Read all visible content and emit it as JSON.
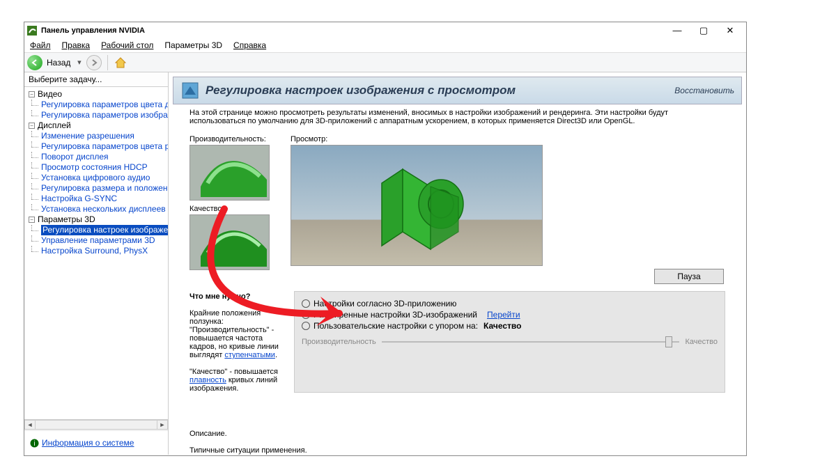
{
  "titlebar": {
    "title": "Панель управления NVIDIA"
  },
  "menu": {
    "file": "Файл",
    "edit": "Правка",
    "desktop": "Рабочий стол",
    "params3d": "Параметры 3D",
    "help": "Справка"
  },
  "toolbar": {
    "back_label": "Назад"
  },
  "sidebar": {
    "header": "Выберите задачу...",
    "groups": [
      {
        "label": "Видео",
        "children": [
          "Регулировка параметров цвета для вид",
          "Регулировка параметров изображения д"
        ]
      },
      {
        "label": "Дисплей",
        "children": [
          "Изменение разрешения",
          "Регулировка параметров цвета рабоче",
          "Поворот дисплея",
          "Просмотр состояния HDCP",
          "Установка цифрового аудио",
          "Регулировка размера и положения рабо",
          "Настройка G-SYNC",
          "Установка нескольких дисплеев"
        ]
      },
      {
        "label": "Параметры 3D",
        "children": [
          "Регулировка настроек изображения с пр",
          "Управление параметрами 3D",
          "Настройка Surround, PhysX"
        ]
      }
    ],
    "selected": "Регулировка настроек изображения с пр",
    "sysinfo": "Информация о системе"
  },
  "page": {
    "title": "Регулировка настроек изображения с просмотром",
    "restore": "Восстановить",
    "description": "На этой странице можно просмотреть результаты изменений, вносимых в настройки изображений и рендеринга. Эти настройки будут использоваться по умолчанию для 3D-приложений с аппаратным ускорением, в которых применяется Direct3D или OpenGL.",
    "perf_label": "Производительность:",
    "quality_label": "Качество:",
    "preview_label": "Просмотр:",
    "pause": "Пауза",
    "options": {
      "by_app": "Настройки согласно 3D-приложению",
      "advanced": "Расширенные настройки 3D-изображений",
      "go_link": "Перейти",
      "custom": "Пользовательские настройки с упором на:",
      "custom_value": "Качество",
      "slider_left": "Производительность",
      "slider_right": "Качество"
    },
    "help": {
      "title": "Что мне нужно?",
      "line1": "Крайние положения ползунка:",
      "line2": "\"Производительность\" - повышается частота кадров, но кривые линии выглядят",
      "link1": "ступенчатыми",
      "dot1": ".",
      "line3": "\"Качество\" - повышается",
      "link2": "плавность",
      "line3b": " кривых линий изображения."
    },
    "descr_label": "Описание.",
    "usage_label": "Типичные ситуации применения."
  }
}
